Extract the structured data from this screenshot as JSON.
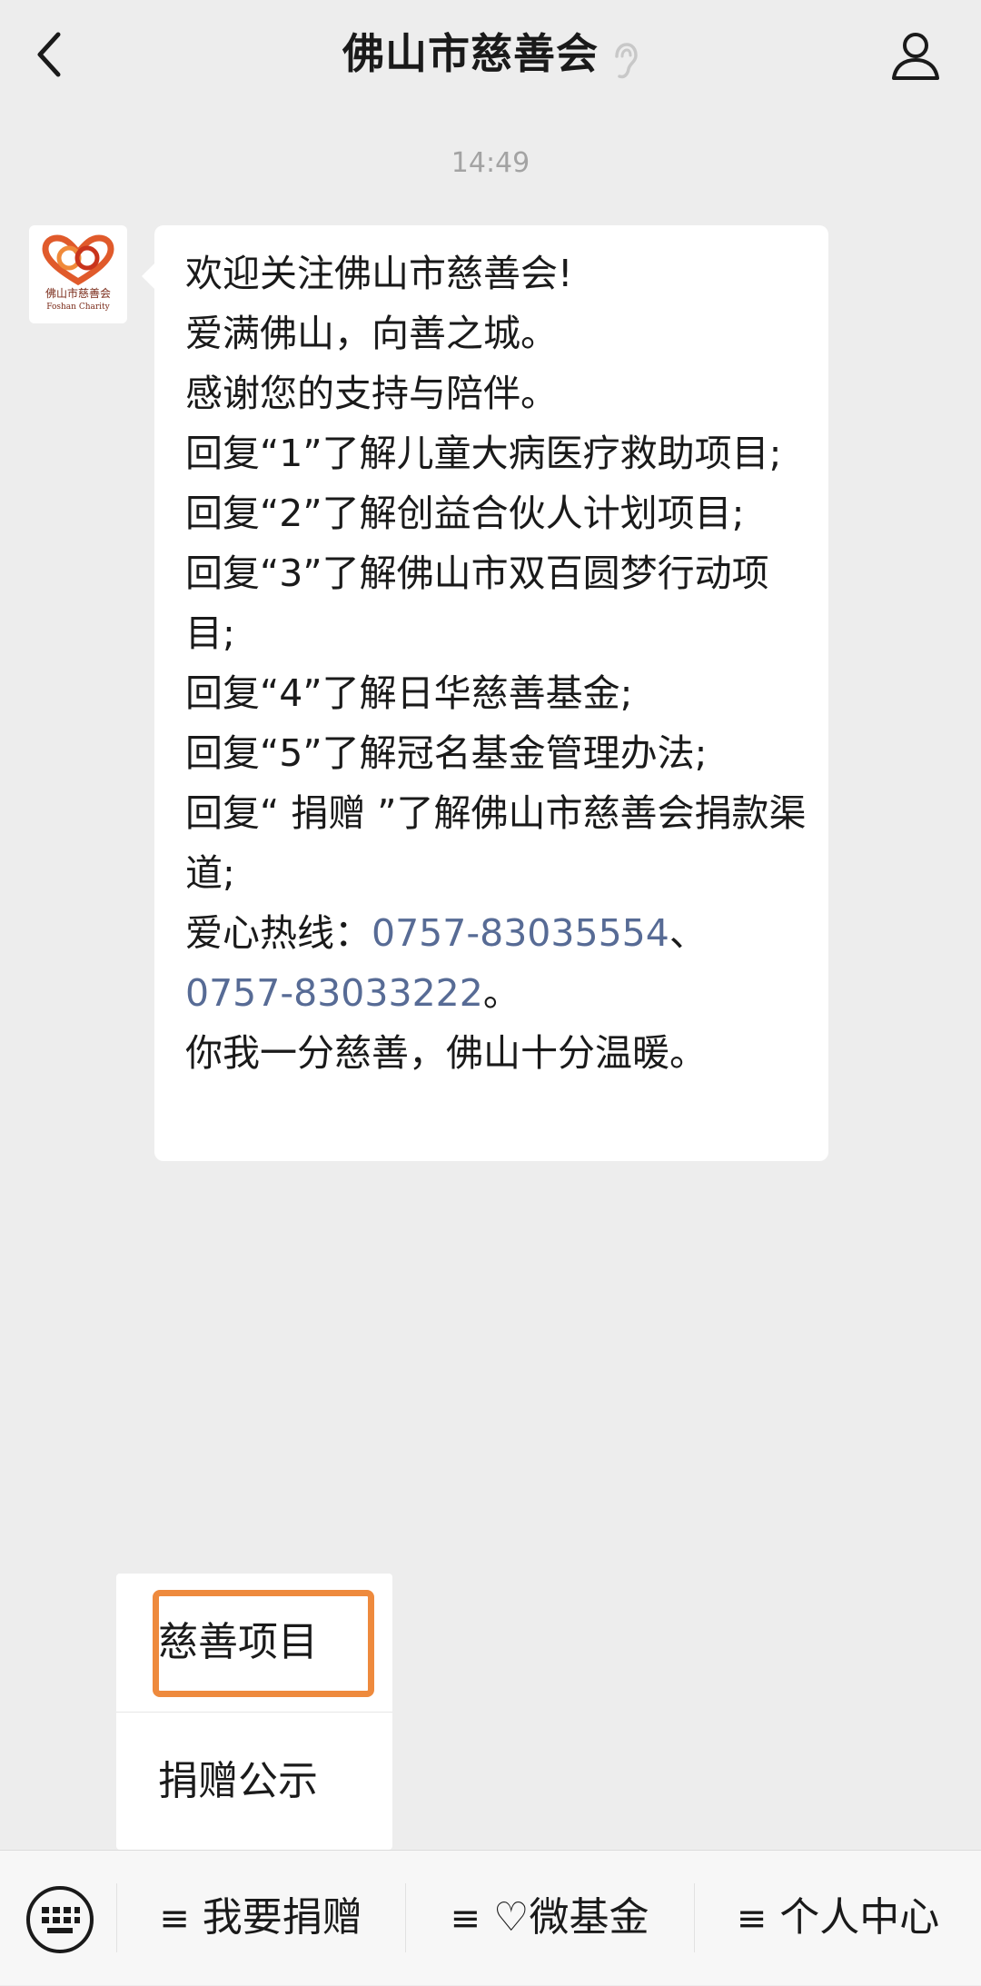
{
  "header": {
    "title": "佛山市慈善会"
  },
  "chat": {
    "time": "14:49",
    "avatar": {
      "name_cn": "佛山市慈善会",
      "name_en": "Foshan Charity"
    },
    "message": {
      "lines": [
        "欢迎关注佛山市慈善会!",
        "爱满佛山，向善之城。",
        "感谢您的支持与陪伴。",
        "回复“1”了解儿童大病医疗救助项目;",
        "回复“2”了解创益合伙人计划项目;",
        "回复“3”了解佛山市双百圆梦行动项目;",
        "回复“4”了解日华慈善基金;",
        "回复“5”了解冠名基金管理办法;",
        "回复“ 捐赠 ”了解佛山市慈善会捐款渠道;"
      ],
      "hotline_label": "爱心热线：",
      "phone1": "0757-83035554",
      "separator": "、",
      "phone2": "0757-83033222",
      "period": "。",
      "closing": "你我一分慈善，佛山十分温暖。"
    }
  },
  "popup": {
    "items": [
      "慈善项目",
      "捐赠公示"
    ],
    "highlight_color": "#ee8a3d"
  },
  "bottom_menu": {
    "menu_icon": "≡",
    "items": [
      "我要捐赠",
      "♡微基金",
      "个人中心"
    ]
  },
  "colors": {
    "background": "#ededed",
    "link": "#576b95",
    "time": "#a3a3a3"
  }
}
